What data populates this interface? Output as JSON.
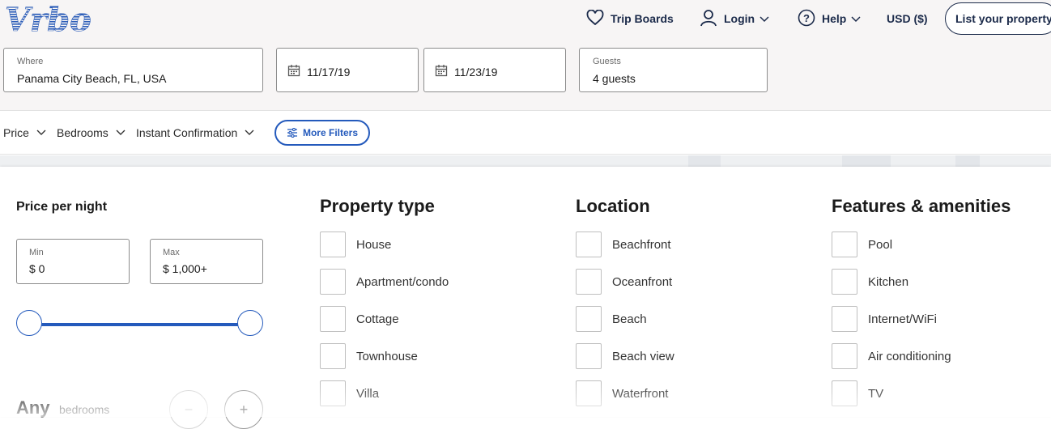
{
  "header": {
    "logo_text": "Vrbo",
    "nav": {
      "trip_boards": "Trip Boards",
      "login": "Login",
      "help": "Help",
      "currency": "USD ($)",
      "list_property": "List your property"
    }
  },
  "search": {
    "where_label": "Where",
    "where_value": "Panama City Beach, FL, USA",
    "checkin": "11/17/19",
    "checkout": "11/23/19",
    "guests_label": "Guests",
    "guests_value": "4 guests"
  },
  "filters": {
    "price": "Price",
    "bedrooms": "Bedrooms",
    "instant": "Instant Confirmation",
    "more": "More Filters"
  },
  "panel": {
    "price_title": "Price per night",
    "min_label": "Min",
    "min_value": "$ 0",
    "max_label": "Max",
    "max_value": "$ 1,000+",
    "bedrooms_value": "Any",
    "bedrooms_label": "bedrooms",
    "minus": "−",
    "plus": "+",
    "property_type": {
      "title": "Property type",
      "items": [
        "House",
        "Apartment/condo",
        "Cottage",
        "Townhouse",
        "Villa"
      ]
    },
    "location": {
      "title": "Location",
      "items": [
        "Beachfront",
        "Oceanfront",
        "Beach",
        "Beach view",
        "Waterfront"
      ]
    },
    "features": {
      "title": "Features & amenities",
      "items": [
        "Pool",
        "Kitchen",
        "Internet/WiFi",
        "Air conditioning",
        "TV"
      ]
    }
  },
  "colors": {
    "brand": "#245abc",
    "navy": "#1b2a4a"
  }
}
